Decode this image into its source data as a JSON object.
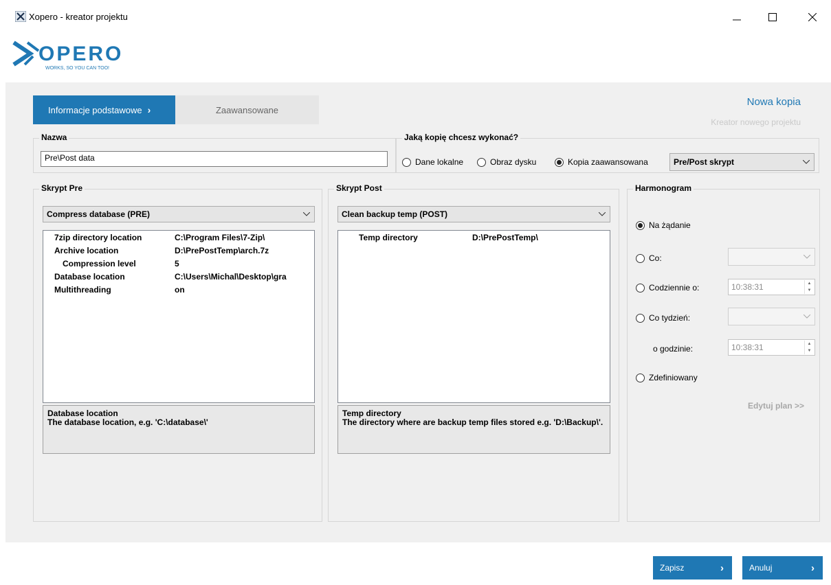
{
  "window": {
    "title": "Xopero - kreator projektu"
  },
  "logo": {
    "wordmark": "OPERO",
    "tagline": "WORKS, SO YOU CAN TOO!"
  },
  "tabs": [
    {
      "label": "Informacje podstawowe",
      "active": true
    },
    {
      "label": "Zaawansowane",
      "active": false
    }
  ],
  "header": {
    "title": "Nowa kopia",
    "subtitle": "Kreator nowego projektu"
  },
  "name_section": {
    "legend": "Nazwa",
    "value": "Pre\\Post data"
  },
  "type_section": {
    "legend": "Jaką kopię chcesz wykonać?",
    "options": [
      {
        "label": "Dane lokalne",
        "selected": false
      },
      {
        "label": "Obraz dysku",
        "selected": false
      },
      {
        "label": "Kopia zaawansowana",
        "selected": true
      }
    ],
    "combo_value": "Pre/Post skrypt"
  },
  "pre": {
    "legend": "Skrypt Pre",
    "combo_value": "Compress database (PRE)",
    "properties": [
      {
        "name": "7zip directory location",
        "value": "C:\\Program Files\\7-Zip\\"
      },
      {
        "name": "Archive location",
        "value": "D:\\PrePostTemp\\arch.7z"
      },
      {
        "name": "Compression level",
        "value": "5"
      },
      {
        "name": "Database location",
        "value": "C:\\Users\\Michal\\Desktop\\gra"
      },
      {
        "name": "Multithreading",
        "value": "on"
      }
    ],
    "description_title": "Database location",
    "description_text": "The database location, e.g. 'C:\\database\\'"
  },
  "post": {
    "legend": "Skrypt Post",
    "combo_value": "Clean backup temp (POST)",
    "properties": [
      {
        "name": "Temp directory",
        "value": "D:\\PrePostTemp\\"
      }
    ],
    "description_title": "Temp directory",
    "description_text": "The directory where are backup temp files stored e.g. 'D:\\Backup\\'."
  },
  "schedule": {
    "legend": "Harmonogram",
    "on_demand": "Na żądanie",
    "every": "Co:",
    "daily_at": "Codziennie o:",
    "daily_time": "10:38:31",
    "weekly": "Co tydzień:",
    "at_hour": "o godzinie:",
    "weekly_time": "10:38:31",
    "defined": "Zdefiniowany",
    "edit_plan": "Edytuj plan >>"
  },
  "footer": {
    "save": "Zapisz",
    "cancel": "Anuluj"
  },
  "colors": {
    "accent": "#1f78b4",
    "panel": "#f0f0f0"
  }
}
